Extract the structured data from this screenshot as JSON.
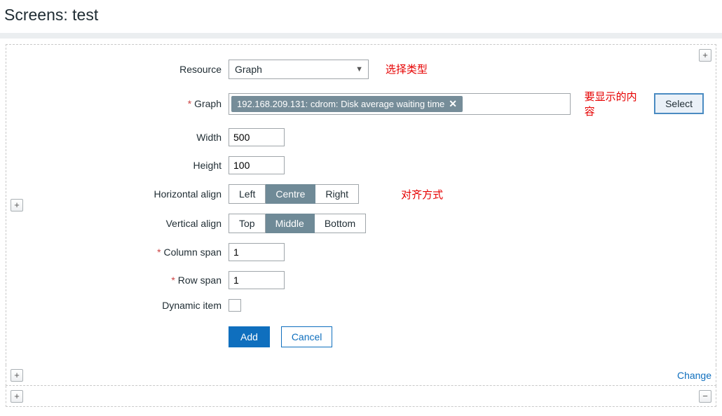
{
  "header": {
    "title": "Screens: test"
  },
  "form": {
    "resource": {
      "label": "Resource",
      "value": "Graph"
    },
    "graph": {
      "label": "Graph",
      "required": true,
      "chip": "192.168.209.131: cdrom: Disk average waiting time",
      "select_btn": "Select"
    },
    "width": {
      "label": "Width",
      "value": "500"
    },
    "height": {
      "label": "Height",
      "value": "100"
    },
    "halign": {
      "label": "Horizontal align",
      "options": [
        "Left",
        "Centre",
        "Right"
      ],
      "active": "Centre"
    },
    "valign": {
      "label": "Vertical align",
      "options": [
        "Top",
        "Middle",
        "Bottom"
      ],
      "active": "Middle"
    },
    "colspan": {
      "label": "Column span",
      "required": true,
      "value": "1"
    },
    "rowspan": {
      "label": "Row span",
      "required": true,
      "value": "1"
    },
    "dynamic": {
      "label": "Dynamic item",
      "checked": false
    },
    "actions": {
      "add": "Add",
      "cancel": "Cancel"
    }
  },
  "annotations": {
    "type": "选择类型",
    "content": "要显示的内容",
    "align": "对齐方式"
  },
  "controls": {
    "plus": "+",
    "minus": "−",
    "change_link": "Change"
  }
}
